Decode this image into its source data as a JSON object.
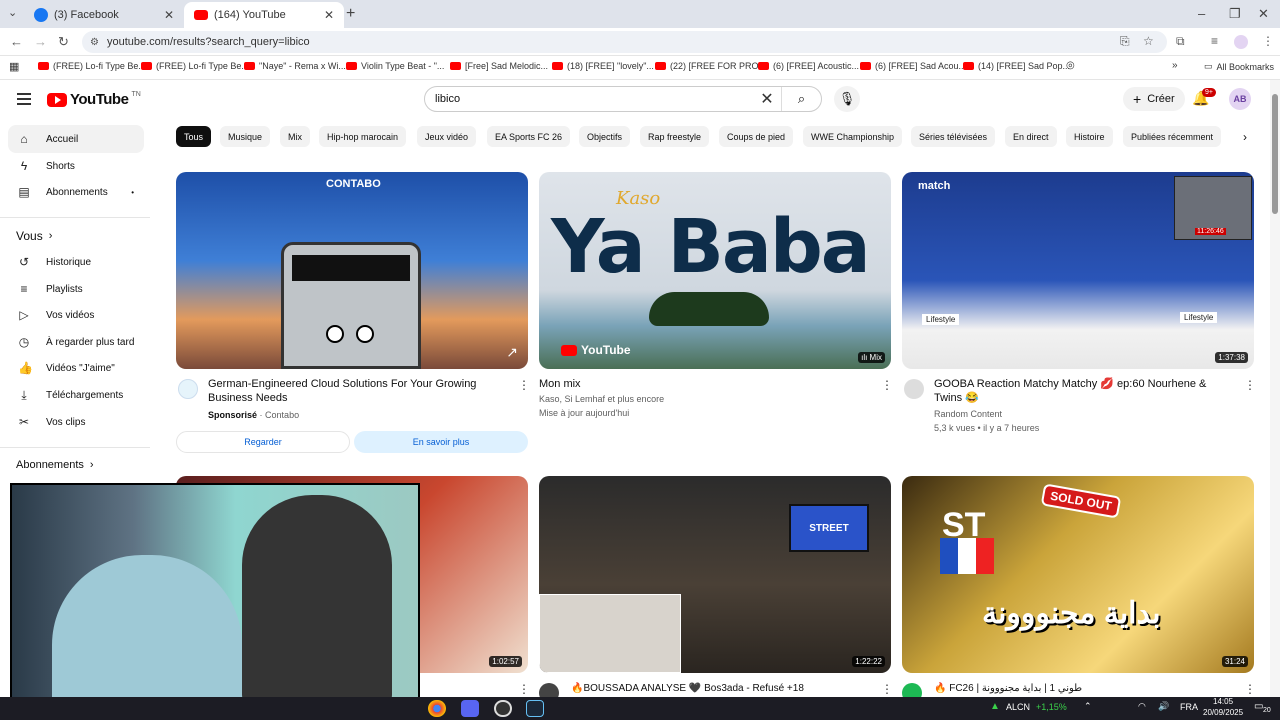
{
  "browser": {
    "tabs": [
      {
        "title": "(3) Facebook"
      },
      {
        "title": "(164) YouTube"
      }
    ],
    "url": "youtube.com/results?search_query=libico",
    "bookmarks": [
      "(FREE) Lo-fi Type Be...",
      "(FREE) Lo-fi Type Be...",
      "\"Naye\" - Rema x Wi...",
      "Violin Type Beat - \"...",
      "[Free] Sad Melodic...",
      "(18) [FREE] \"lovely\"...",
      "(22) [FREE FOR PRO...",
      "(6) [FREE] Acoustic...",
      "(6) [FREE] Sad Acou...",
      "(14) [FREE] Sad Pop..."
    ],
    "all_bookmarks": "All Bookmarks"
  },
  "youtube": {
    "logo_text": "YouTube",
    "logo_suffix": "TN",
    "search_value": "libico",
    "create_label": "Créer",
    "notif_count": "9+",
    "avatar_initials": "AB"
  },
  "sidebar": {
    "items_top": [
      "Accueil",
      "Shorts",
      "Abonnements"
    ],
    "you_header": "Vous",
    "items_you": [
      "Historique",
      "Playlists",
      "Vos vidéos",
      "À regarder plus tard",
      "Vidéos \"J'aime\"",
      "Téléchargements",
      "Vos clips"
    ],
    "subs_header": "Abonnements"
  },
  "chips": [
    "Tous",
    "Musique",
    "Mix",
    "Hip-hop marocain",
    "Jeux vidéo",
    "EA Sports FC 26",
    "Objectifs",
    "Rap freestyle",
    "Coups de pied",
    "WWE Championship",
    "Séries télévisées",
    "En direct",
    "Histoire",
    "Publiées récemment"
  ],
  "videos": {
    "ad": {
      "brand": "CONTABO",
      "title": "German-Engineered Cloud Solutions For Your Growing Business Needs",
      "sponsored": "Sponsorisé",
      "sep": "·",
      "channel": "Contabo",
      "btn_watch": "Regarder",
      "btn_more": "En savoir plus"
    },
    "mix": {
      "thumb_script": "Kaso",
      "thumb_big": "Ya Baba",
      "thumb_brand": "YouTube",
      "badge": "Mix",
      "title": "Mon mix",
      "line1": "Kaso, Si Lemhaf et plus encore",
      "line2": "Mise à jour aujourd'hui"
    },
    "gooba": {
      "brand": "match",
      "tag_left": "Lifestyle",
      "tag_right": "Lifestyle",
      "overlay_time": "11:26:46",
      "duration": "1:37:38",
      "title": "GOOBA Reaction Matchy Matchy 💋 ep:60 Nourhene & Twins 😂",
      "channel": "Random Content",
      "meta": "5,3 k vues • il y a 7 heures"
    },
    "row2": [
      {
        "duration": "1:02:57",
        "title": "عصام الش..."
      },
      {
        "duration": "1:22:22",
        "title": "🔥BOUSSADA ANALYSE 🖤 Bos3ada - Refusé +18",
        "thumb_text": "STREET"
      },
      {
        "duration": "31:24",
        "title": "🔥 FC26 | طوني 1 | بداية مجنووونة",
        "thumb_st": "ST",
        "thumb_sold": "SOLD OUT",
        "thumb_ar": "بداية مجنووونة"
      }
    ]
  },
  "taskbar": {
    "ticker": "ALCN",
    "change": "+1,15%",
    "lang": "FRA",
    "time": "14:05",
    "date": "20/09/2025",
    "notif": "20"
  },
  "colors": {
    "yt_red": "#ff0000",
    "chip_active": "#0f0f0f",
    "link_blue": "#065fd4"
  }
}
